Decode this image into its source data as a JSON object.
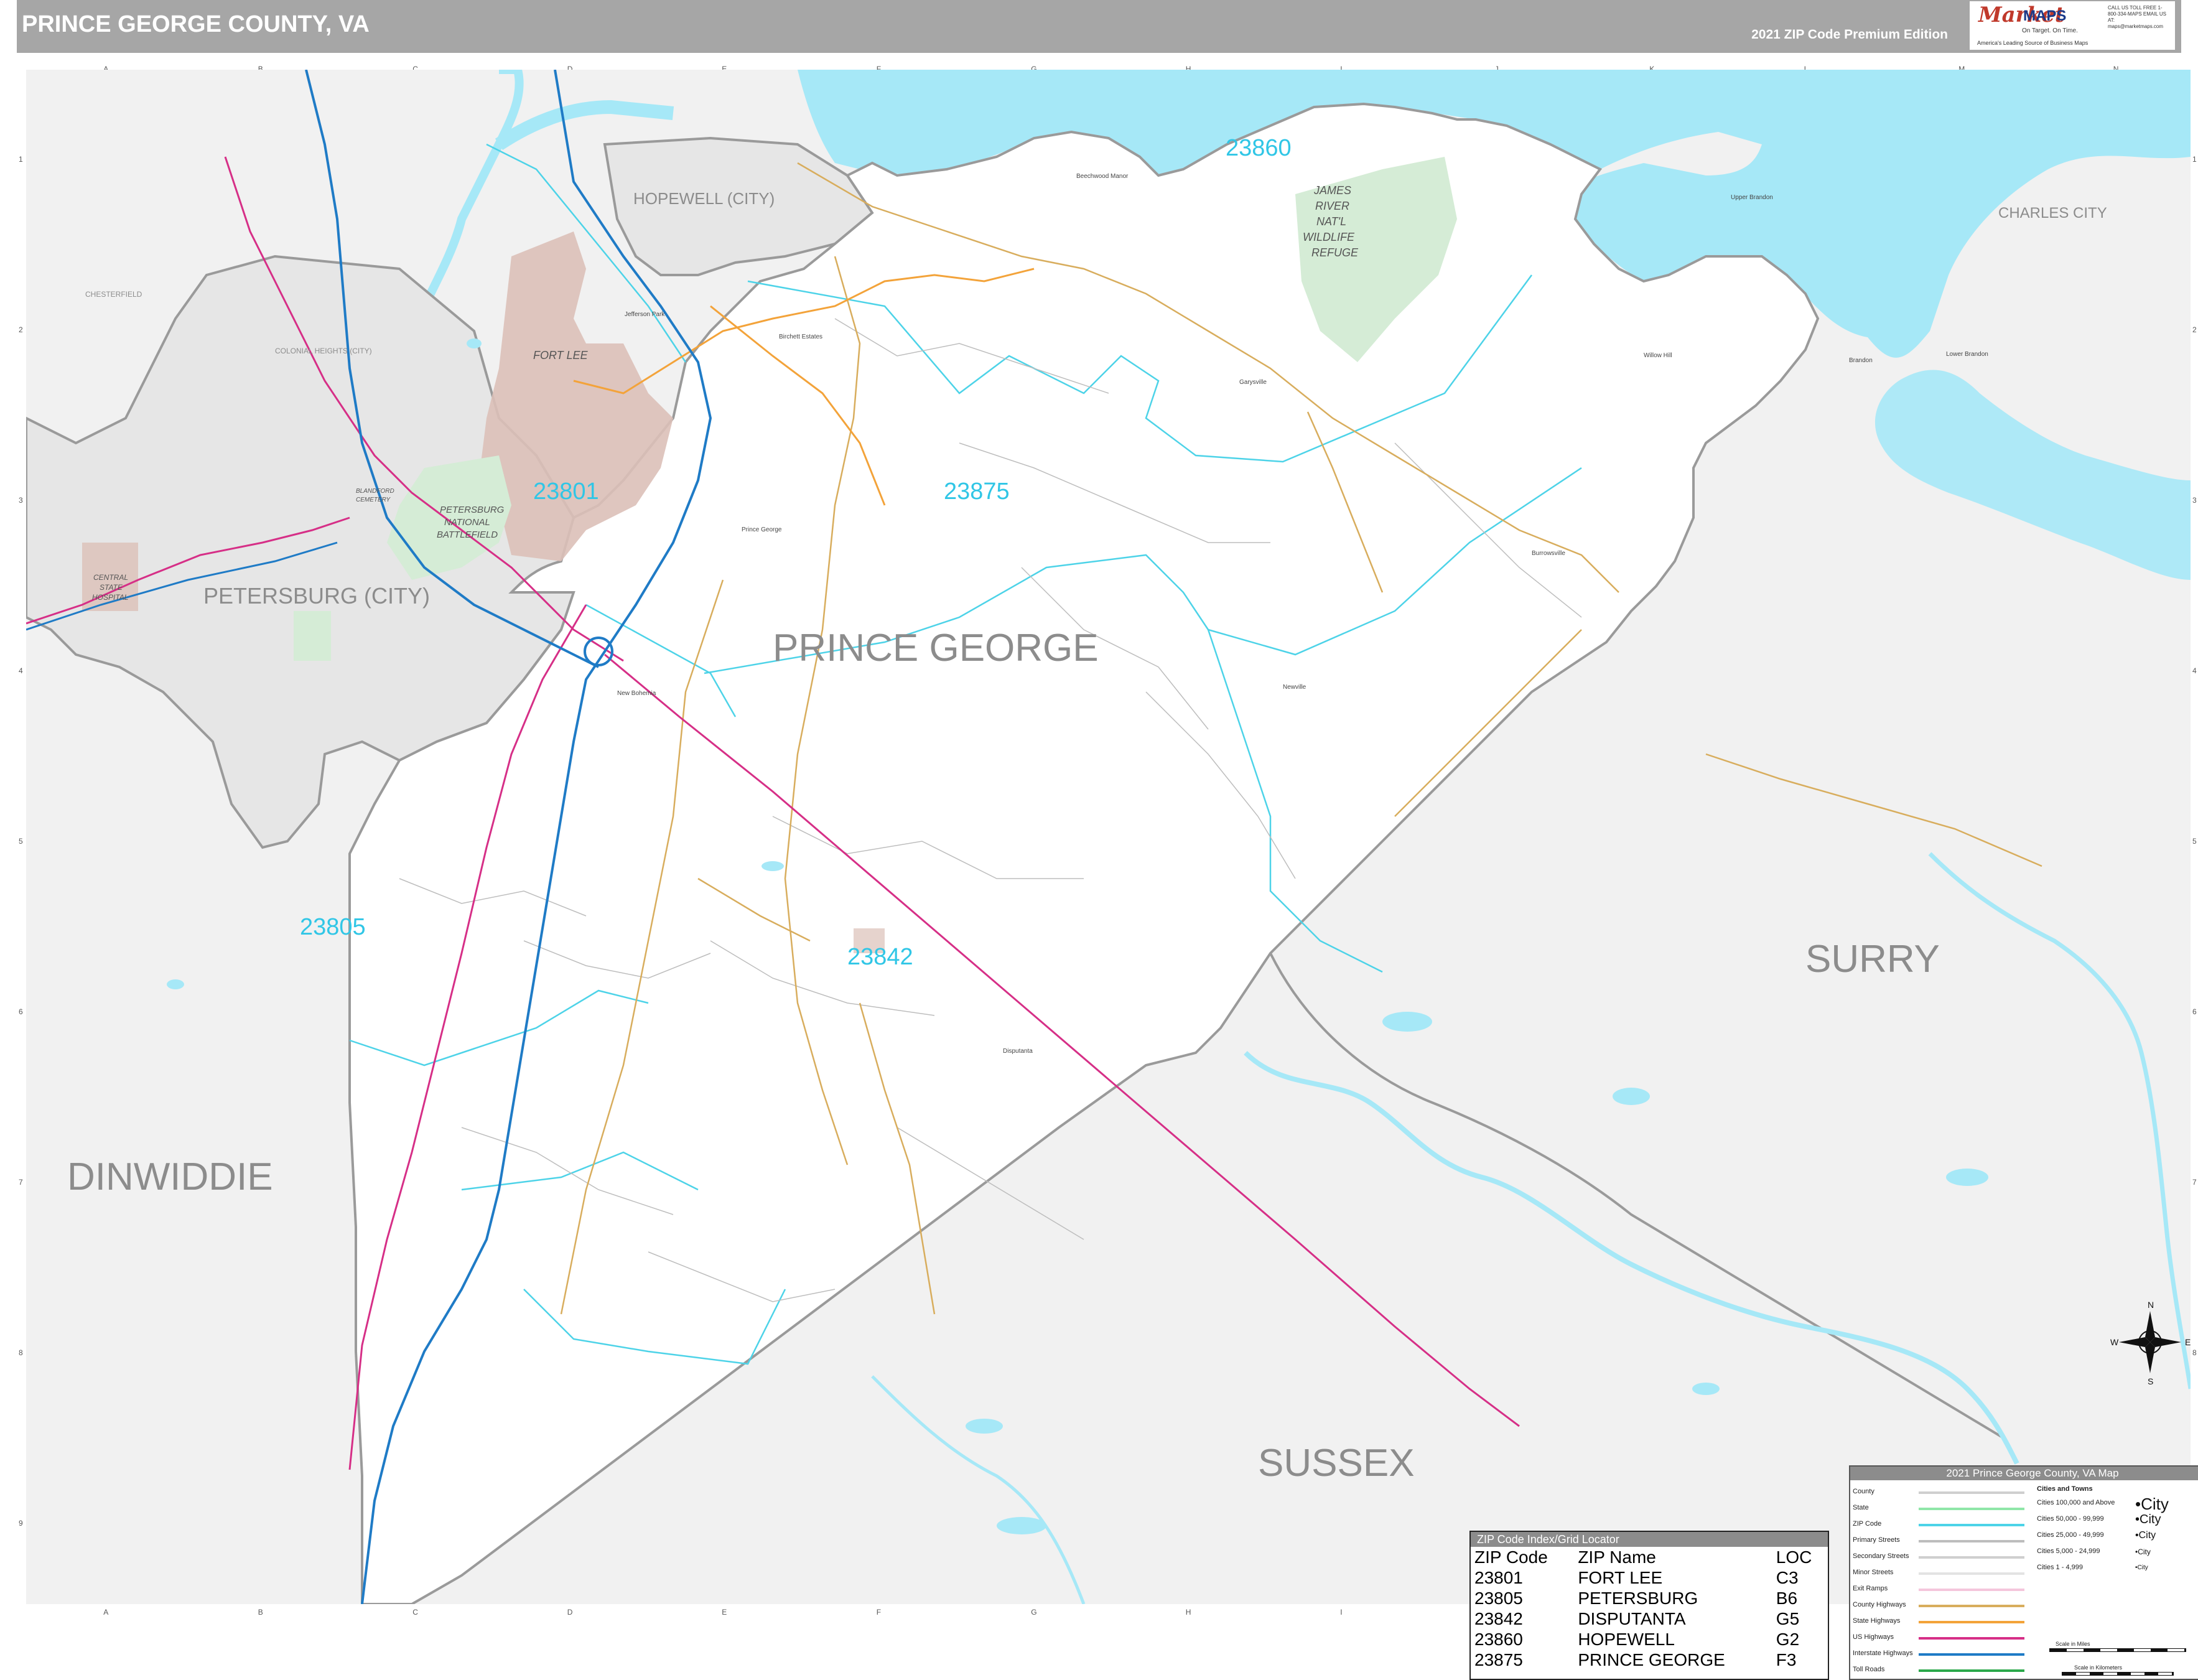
{
  "header": {
    "title": "PRINCE GEORGE COUNTY, VA",
    "edition": "2021 ZIP Code Premium Edition",
    "logo_brand": "Market",
    "logo_brand2": "MAPS",
    "logo_tagline": "On Target. On Time.",
    "logo_subline": "America's Leading Source of Business Maps",
    "logo_contact": "CALL US TOLL FREE 1-800-334-MAPS EMAIL US AT: maps@marketmaps.com"
  },
  "grid": {
    "columns": [
      "A",
      "B",
      "C",
      "D",
      "E",
      "F",
      "G",
      "H",
      "I",
      "J",
      "K",
      "L",
      "M",
      "N"
    ],
    "rows": [
      "1",
      "2",
      "3",
      "4",
      "5",
      "6",
      "7",
      "8",
      "9"
    ]
  },
  "map": {
    "county_label": "PRINCE GEORGE",
    "neighbors": [
      {
        "id": "dinwiddie",
        "label": "DINWIDDIE"
      },
      {
        "id": "surry",
        "label": "SURRY"
      },
      {
        "id": "sussex",
        "label": "SUSSEX"
      },
      {
        "id": "petersburg",
        "label": "PETERSBURG (CITY)"
      },
      {
        "id": "hopewell",
        "label": "HOPEWELL (CITY)"
      },
      {
        "id": "charles_city",
        "label": "CHARLES CITY"
      },
      {
        "id": "colonial_heights",
        "label": "COLONIAL HEIGHTS (CITY)"
      },
      {
        "id": "chesterfield",
        "label": "CHESTERFIELD"
      }
    ],
    "zip_labels": [
      "23860",
      "23875",
      "23801",
      "23805",
      "23842"
    ],
    "area_labels": {
      "fort_lee": "FORT LEE",
      "wildlife_refuge": [
        "JAMES",
        "RIVER",
        "NAT'L",
        "WILDLIFE",
        "REFUGE"
      ],
      "battlefield": [
        "PETERSBURG",
        "NATIONAL",
        "BATTLEFIELD"
      ],
      "hospital": [
        "CENTRAL",
        "STATE",
        "HOSPITAL"
      ],
      "cemetery": [
        "BLANDFORD",
        "CEMETERY"
      ]
    },
    "places": [
      "Prince George",
      "Disputanta",
      "Burrowsville",
      "Garysville",
      "Newville",
      "Upper Brandon",
      "Brandon",
      "Lower Brandon",
      "Willow Hill",
      "Beechwood Manor",
      "Jefferson Park",
      "Birchett Estates",
      "New Bohemia"
    ],
    "compass": {
      "n": "N",
      "e": "E",
      "s": "S",
      "w": "W"
    },
    "colors": {
      "water": "#a6e8f7",
      "neighbor": "#f1f1f1",
      "county": "#ffffff",
      "military": "#dcc0b8",
      "park": "#d5ecd6",
      "zip_line": "#4dd3e8",
      "zip_text": "#30c6e6",
      "interstate": "#1f7bc6",
      "us_highway": "#d62f87",
      "state_highway": "#f3a33a",
      "county_highway": "#d8ad5d"
    }
  },
  "zip_index": {
    "title": "ZIP Code Index/Grid Locator",
    "headers": [
      "ZIP Code",
      "ZIP Name",
      "LOC"
    ],
    "rows": [
      [
        "23801",
        "FORT LEE",
        "C3"
      ],
      [
        "23805",
        "PETERSBURG",
        "B6"
      ],
      [
        "23842",
        "DISPUTANTA",
        "G5"
      ],
      [
        "23860",
        "HOPEWELL",
        "G2"
      ],
      [
        "23875",
        "PRINCE GEORGE",
        "F3"
      ]
    ]
  },
  "legend": {
    "title": "2021 Prince George County, VA Map",
    "items": [
      "County",
      "State",
      "ZIP Code",
      "Primary Streets",
      "Secondary Streets",
      "Minor Streets",
      "Exit Ramps",
      "County Highways",
      "State Highways",
      "US Highways",
      "Interstate Highways",
      "Toll Roads"
    ],
    "cities_heading": "Cities and Towns",
    "cities": [
      {
        "range": "Cities 100,000 and Above",
        "sample": "City"
      },
      {
        "range": "Cities 50,000 - 99,999",
        "sample": "City"
      },
      {
        "range": "Cities 25,000 - 49,999",
        "sample": "City"
      },
      {
        "range": "Cities 5,000 - 24,999",
        "sample": "City"
      },
      {
        "range": "Cities 1 - 4,999",
        "sample": "City"
      }
    ],
    "scale_miles": "Scale in Miles",
    "scale_km": "Scale in Kilometers"
  }
}
